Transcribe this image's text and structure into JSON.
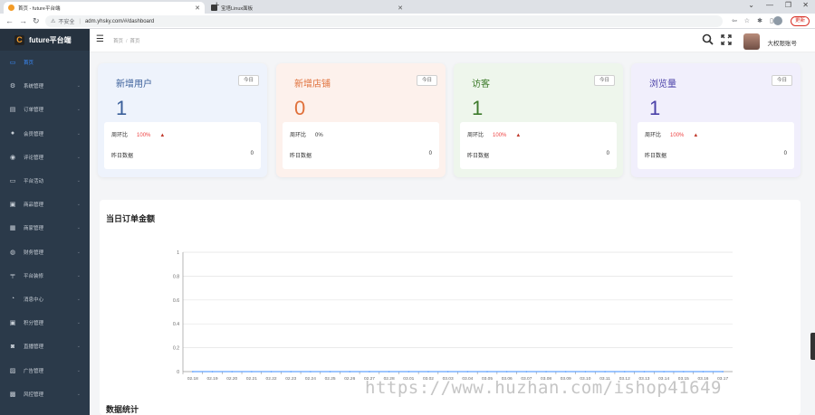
{
  "browser": {
    "tabs": [
      {
        "title": "首页 - future平台端",
        "active": true
      },
      {
        "title": "宝塔Linux面板",
        "active": false
      }
    ],
    "address": {
      "security": "不安全",
      "url": "adm.yhsky.com/#/dashboard"
    },
    "update_label": "更新"
  },
  "app": {
    "brand": "future平台端",
    "brand_logo": "C",
    "sidebar": {
      "items": [
        {
          "label": "首页",
          "icon": "monitor-icon",
          "active": true
        },
        {
          "label": "系统管理",
          "icon": "gear-icon"
        },
        {
          "label": "订单管理",
          "icon": "document-icon"
        },
        {
          "label": "会员管理",
          "icon": "user-icon"
        },
        {
          "label": "评论管理",
          "icon": "comment-icon"
        },
        {
          "label": "平台活动",
          "icon": "screen-icon"
        },
        {
          "label": "商品管理",
          "icon": "gift-icon"
        },
        {
          "label": "商家管理",
          "icon": "store-icon"
        },
        {
          "label": "财务管理",
          "icon": "finance-icon"
        },
        {
          "label": "平台装修",
          "icon": "decorate-icon"
        },
        {
          "label": "消息中心",
          "icon": "message-icon"
        },
        {
          "label": "积分管理",
          "icon": "points-icon"
        },
        {
          "label": "直播管理",
          "icon": "live-icon"
        },
        {
          "label": "广告管理",
          "icon": "ad-icon"
        },
        {
          "label": "风控管理",
          "icon": "risk-icon"
        }
      ]
    },
    "header": {
      "breadcrumb": [
        "首页",
        "首页"
      ],
      "username": "大权限账号"
    }
  },
  "dashboard": {
    "cards": [
      {
        "title": "新增用户",
        "tag": "今日",
        "value": "1",
        "ratio_label": "周环比",
        "ratio_value": "100%",
        "ratio_up": true,
        "yesterday_label": "昨日数据",
        "yesterday_value": "0",
        "color": "#3a5f9a",
        "bg": "#eef3fc"
      },
      {
        "title": "新增店铺",
        "tag": "今日",
        "value": "0",
        "ratio_label": "周环比",
        "ratio_value": "0%",
        "ratio_up": false,
        "yesterday_label": "昨日数据",
        "yesterday_value": "0",
        "color": "#e0703a",
        "bg": "#fdf1ec"
      },
      {
        "title": "访客",
        "tag": "今日",
        "value": "1",
        "ratio_label": "周环比",
        "ratio_value": "100%",
        "ratio_up": true,
        "yesterday_label": "昨日数据",
        "yesterday_value": "0",
        "color": "#3c7a2a",
        "bg": "#eef6ec"
      },
      {
        "title": "浏览量",
        "tag": "今日",
        "value": "1",
        "ratio_label": "周环比",
        "ratio_value": "100%",
        "ratio_up": true,
        "yesterday_label": "昨日数据",
        "yesterday_value": "0",
        "color": "#4a40a8",
        "bg": "#f1effc"
      }
    ],
    "chart_title": "当日订单金额",
    "stats_title": "数据统计"
  },
  "chart_data": {
    "type": "line",
    "title": "当日订单金额",
    "x": [
      "02.18",
      "02.19",
      "02.20",
      "02.21",
      "02.22",
      "02.23",
      "02.24",
      "02.25",
      "02.26",
      "02.27",
      "02.28",
      "03.01",
      "03.02",
      "03.03",
      "03.04",
      "03.05",
      "03.06",
      "03.07",
      "03.08",
      "03.09",
      "03.10",
      "03.11",
      "03.12",
      "03.13",
      "03.14",
      "03.15",
      "03.16",
      "03.17"
    ],
    "series": [
      {
        "values": [
          0,
          0,
          0,
          0,
          0,
          0,
          0,
          0,
          0,
          0,
          0,
          0,
          0,
          0,
          0,
          0,
          0,
          0,
          0,
          0,
          0,
          0,
          0,
          0,
          0,
          0,
          0,
          0
        ]
      }
    ],
    "yticks": [
      "0",
      "0.2",
      "0.4",
      "0.6",
      "0.8",
      "1"
    ],
    "ylim": [
      0,
      1
    ],
    "grid": true,
    "line_color": "#3b8cff"
  },
  "watermark": "https://www.huzhan.com/ishop41649"
}
